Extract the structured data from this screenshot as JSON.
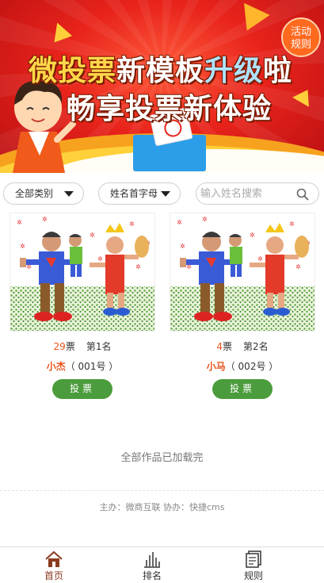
{
  "banner": {
    "headline_1a": "微投票",
    "headline_1b": "新模板",
    "headline_1c": "升级",
    "headline_1d": "啦",
    "headline_2": "畅享投票新体验",
    "rules_badge_line1": "活动",
    "rules_badge_line2": "规则"
  },
  "filters": {
    "category": "全部类别",
    "initial": "姓名首字母",
    "search_placeholder": "输入姓名搜索"
  },
  "entries": [
    {
      "votes": "29",
      "votes_unit": "票",
      "rank": "第1名",
      "name": "小杰",
      "number": "（ 001号 ）",
      "vote_label": "投票"
    },
    {
      "votes": "4",
      "votes_unit": "票",
      "rank": "第2名",
      "name": "小马",
      "number": "（ 002号 ）",
      "vote_label": "投票"
    }
  ],
  "status": {
    "all_loaded": "全部作品已加载完"
  },
  "footer": {
    "credit": "主办：微商互联 协办：快捷cms"
  },
  "tabbar": {
    "home": "首页",
    "ranking": "排名",
    "rules": "规则"
  },
  "colors": {
    "accent_orange": "#e8541b",
    "vote_green": "#4b9c3c",
    "banner_red": "#e8231b"
  }
}
